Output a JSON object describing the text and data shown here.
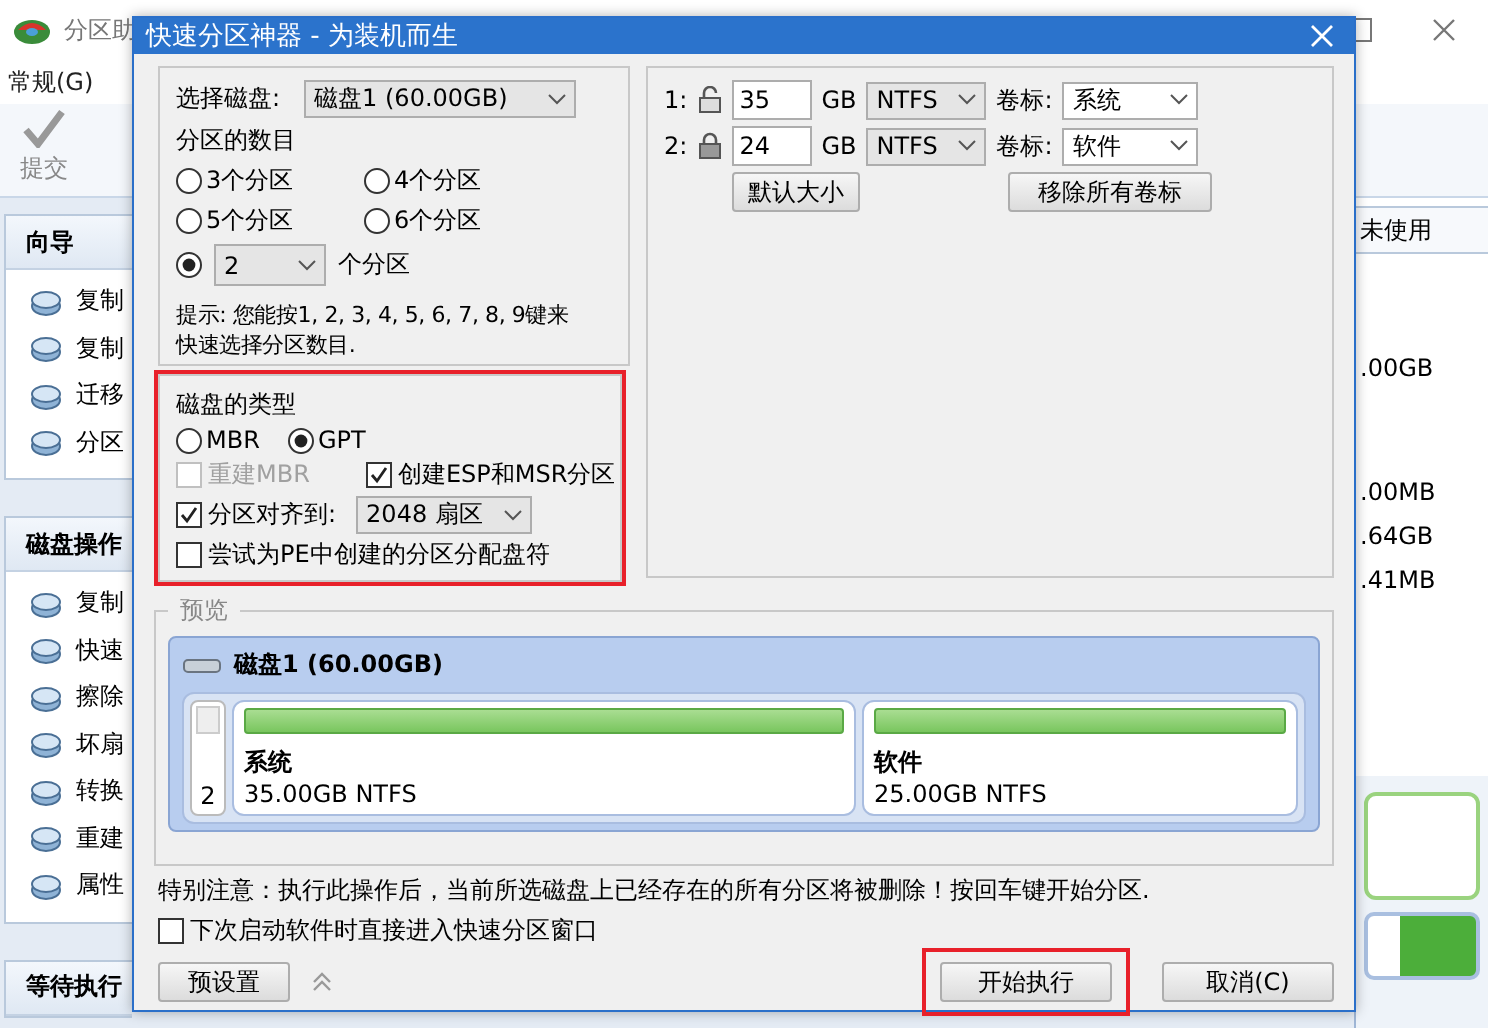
{
  "app": {
    "title": "分区助",
    "menu": [
      "常规(G)"
    ],
    "toolbar": [
      {
        "label": "提交",
        "disabled": true
      }
    ],
    "wizard": {
      "title": "向导",
      "items": [
        "复制",
        "复制",
        "迁移",
        "分区"
      ]
    },
    "disk_ops": {
      "title": "磁盘操作",
      "items": [
        "复制",
        "快速",
        "擦除",
        "坏扇",
        "转换",
        "重建",
        "属性"
      ]
    },
    "pending": {
      "title": "等待执行"
    },
    "table": {
      "column": "未使用",
      "cells": [
        ".00GB",
        ".00MB",
        ".64GB",
        ".41MB"
      ]
    }
  },
  "dialog": {
    "title": "快速分区神器 - 为装机而生",
    "disk_select": {
      "label": "选择磁盘:",
      "value": "磁盘1 (60.00GB)"
    },
    "count": {
      "title": "分区的数目",
      "options": [
        {
          "label": "3个分区",
          "selected": false
        },
        {
          "label": "4个分区",
          "selected": false
        },
        {
          "label": "5个分区",
          "selected": false
        },
        {
          "label": "6个分区",
          "selected": false
        }
      ],
      "custom": {
        "value": "2",
        "suffix": "个分区",
        "selected": true
      }
    },
    "hint_lines": [
      "提示: 您能按1, 2, 3, 4, 5, 6, 7, 8, 9键来",
      "快速选择分区数目."
    ],
    "disk_type": {
      "title": "磁盘的类型",
      "highlighted": true,
      "options": [
        {
          "label": "MBR",
          "selected": false
        },
        {
          "label": "GPT",
          "selected": true
        }
      ],
      "checks": [
        {
          "label": "重建MBR",
          "checked": false,
          "disabled": true
        },
        {
          "label": "创建ESP和MSR分区",
          "checked": true,
          "disabled": false
        },
        {
          "label": "分区对齐到:",
          "checked": true,
          "disabled": false,
          "select": "2048 扇区"
        },
        {
          "label": "尝试为PE中创建的分区分配盘符",
          "checked": false,
          "disabled": false
        }
      ]
    },
    "partitions": [
      {
        "index": "1:",
        "locked": false,
        "size": "35",
        "unit": "GB",
        "fs": "NTFS",
        "label_caption": "卷标:",
        "label": "系统"
      },
      {
        "index": "2:",
        "locked": true,
        "size": "24",
        "unit": "GB",
        "fs": "NTFS",
        "label_caption": "卷标:",
        "label": "软件"
      }
    ],
    "default_size_button": "默认大小",
    "remove_labels_button": "移除所有卷标",
    "preview": {
      "title": "预览",
      "disk": "磁盘1 (60.00GB)",
      "count": "2",
      "parts": [
        {
          "name": "系统",
          "info": "35.00GB NTFS"
        },
        {
          "name": "软件",
          "info": "25.00GB NTFS"
        }
      ]
    },
    "warning": "特别注意：执行此操作后，当前所选磁盘上已经存在的所有分区将被删除！按回车键开始分区.",
    "startup_check": {
      "label": "下次启动软件时直接进入快速分区窗口",
      "checked": false
    },
    "preset_button": "预设置",
    "start_button": {
      "label": "开始执行",
      "highlighted": true
    },
    "cancel_button": "取消(C)"
  }
}
